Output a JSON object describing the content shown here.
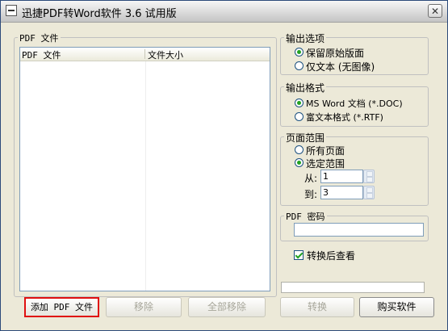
{
  "window": {
    "title": "迅捷PDF转Word软件 3.6 试用版",
    "close_glyph": "✕"
  },
  "pdf_group": {
    "legend": "PDF 文件",
    "columns": [
      "PDF 文件",
      "文件大小"
    ]
  },
  "output_options": {
    "legend": "输出选项",
    "items": [
      {
        "label": "保留原始版面",
        "selected": true
      },
      {
        "label": "仅文本 (无图像)",
        "selected": false
      }
    ]
  },
  "output_format": {
    "legend": "输出格式",
    "items": [
      {
        "label": "MS Word 文档 (*.DOC)",
        "selected": true
      },
      {
        "label": "富文本格式 (*.RTF)",
        "selected": false
      }
    ]
  },
  "page_range": {
    "legend": "页面范围",
    "items": [
      {
        "label": "所有页面",
        "selected": false
      },
      {
        "label": "选定范围",
        "selected": true
      }
    ],
    "from_label": "从:",
    "from_value": "1",
    "to_label": "到:",
    "to_value": "3"
  },
  "password": {
    "legend": "PDF 密码",
    "value": ""
  },
  "view_after": {
    "label": "转换后查看",
    "checked": true
  },
  "buttons": {
    "add": "添加 PDF 文件",
    "remove": "移除",
    "remove_all": "全部移除",
    "convert": "转换",
    "buy": "购买软件"
  },
  "accent": {
    "selected_green": "#21a121",
    "highlight_red": "#e01010"
  }
}
